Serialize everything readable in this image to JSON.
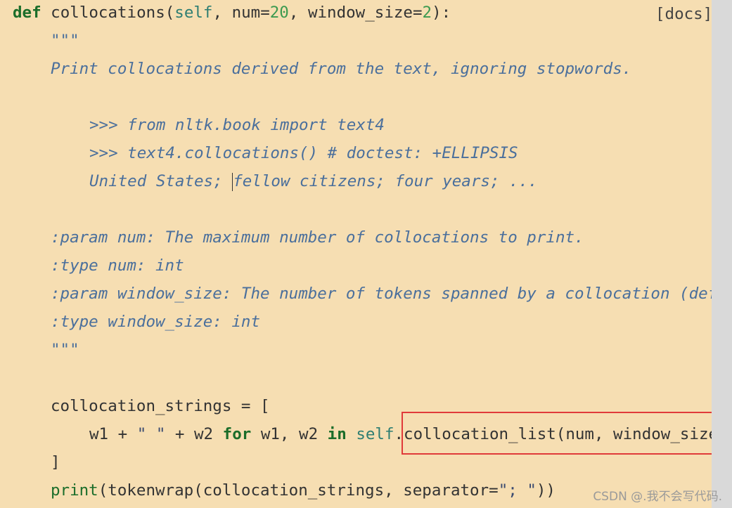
{
  "code": {
    "line_def": {
      "kw": "def",
      "name": " collocations(",
      "self": "self",
      "mid": ", num=",
      "num_val": "20",
      "mid2": ", window_size=",
      "ws_val": "2",
      "end": "):"
    },
    "docs_link": "[docs]",
    "doc_open": "\"\"\"",
    "doc_summary": "Print collocations derived from the text, ignoring stopwords.",
    "doctest1": ">>> from nltk.book import text4",
    "doctest2": ">>> text4.collocations() # doctest: +ELLIPSIS",
    "doctest3_a": "United States; ",
    "doctest3_b": "fellow citizens; four years; ...",
    "param_num": ":param num: The maximum number of collocations to print.",
    "type_num": ":type num: int",
    "param_window": ":param window_size: The number of tokens spanned by a collocation (defau",
    "type_window": ":type window_size: int",
    "doc_close": "\"\"\"",
    "assign_line": "collocation_strings = [",
    "comp_line": {
      "a": "w1 + ",
      "str1": "\" \"",
      "b": " + w2 ",
      "kw_for": "for",
      "c": " w1, w2 ",
      "kw_in": "in",
      "d": " ",
      "self": "self",
      "e": ".collocation_list(num, window_size)"
    },
    "close_bracket": "]",
    "print_line": {
      "fn": "print",
      "a": "(tokenwrap(collocation_strings, separator=",
      "str": "\"; \"",
      "b": "))"
    }
  },
  "watermark": "CSDN @.我不会写代码.",
  "colors": {
    "background": "#f6deb2",
    "docstring": "#4a6f9c",
    "keyword": "#1b6d2a",
    "highlight_box": "#e03a3a"
  }
}
